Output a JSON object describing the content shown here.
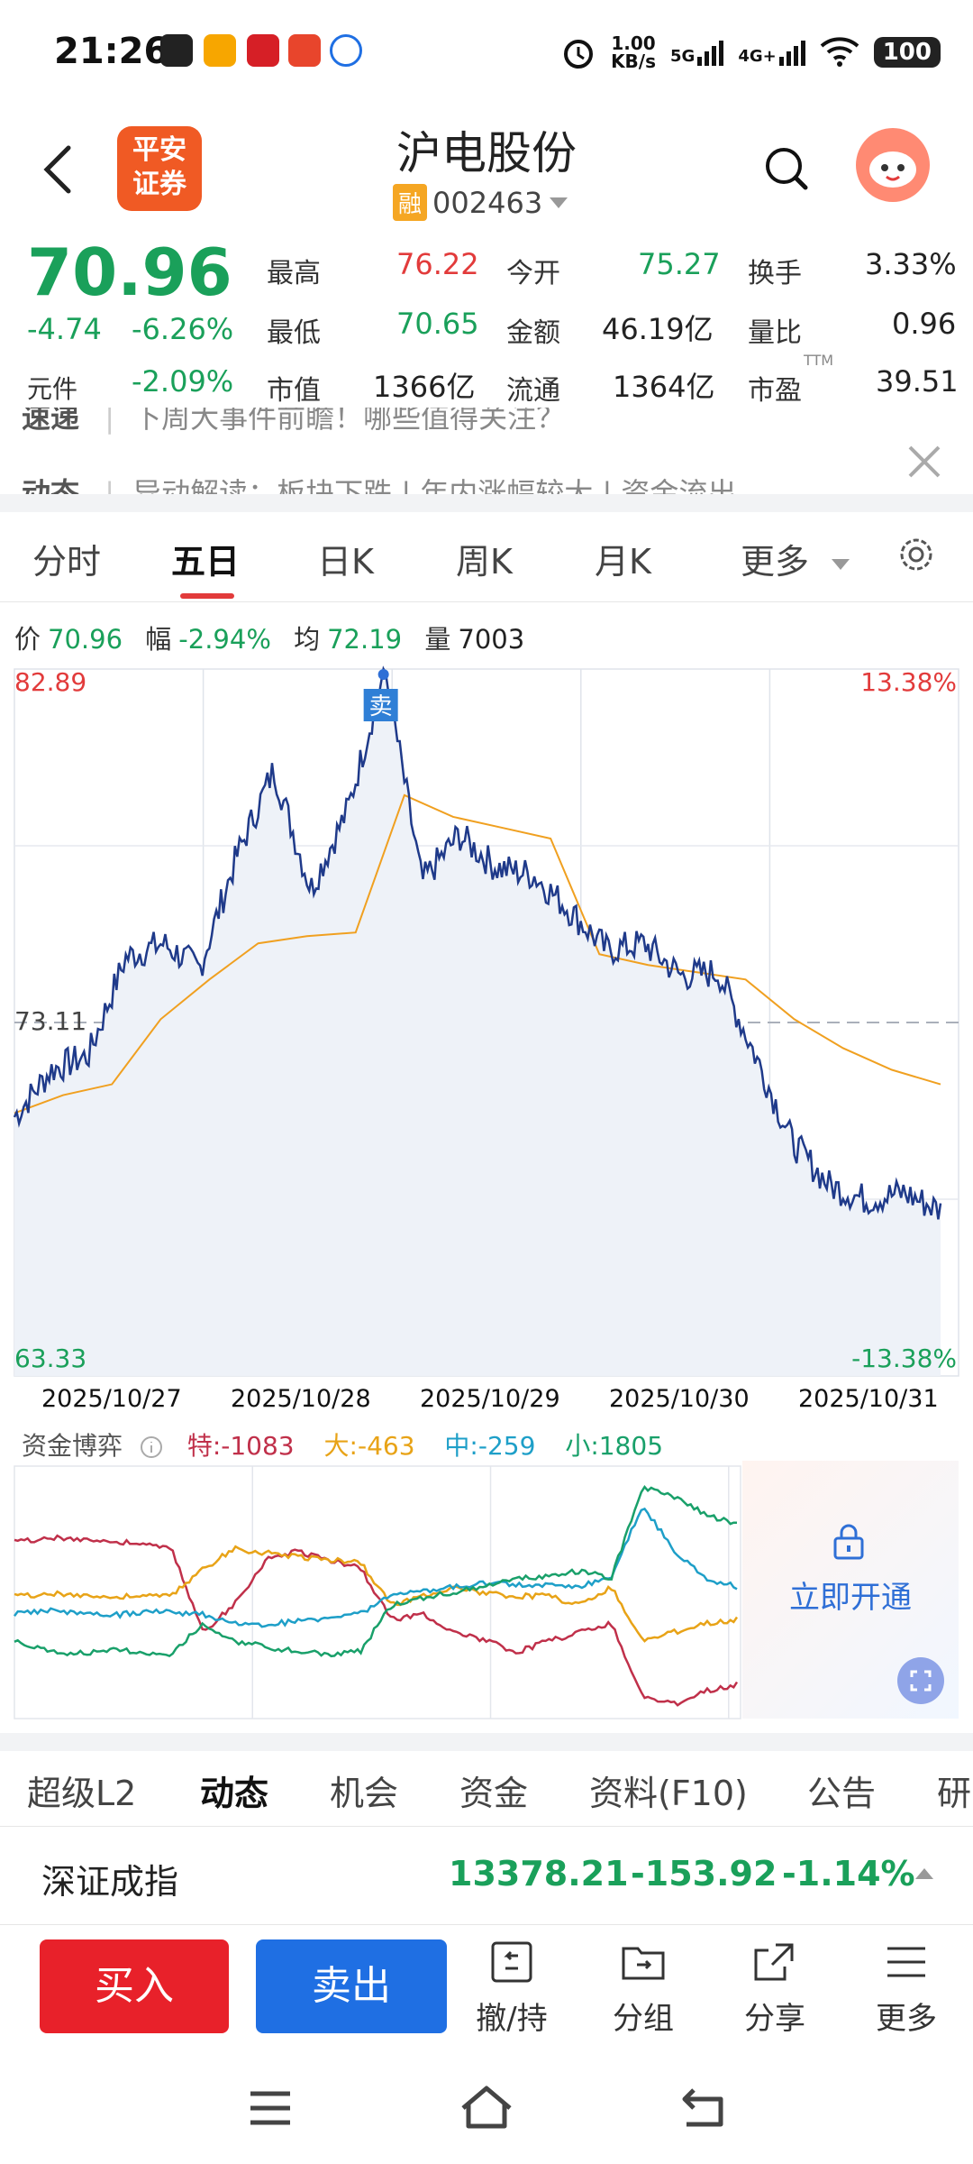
{
  "status_bar": {
    "time": "21:26",
    "net_speed_value": "1.00",
    "net_speed_unit": "KB/s",
    "sig1": "5G",
    "sig2": "4G+",
    "battery": "100"
  },
  "header": {
    "logo_text_1": "平安",
    "logo_text_2": "证券",
    "stock_name": "沪电股份",
    "rong_badge": "融",
    "stock_code": "002463"
  },
  "quote": {
    "price": "70.96",
    "change": "-4.74",
    "change_pct": "-6.26%",
    "yuanjian_label": "元件",
    "yuanjian_value": "-2.09%",
    "high_label": "最高",
    "high_value": "76.22",
    "low_label": "最低",
    "low_value": "70.65",
    "mktcap_label": "市值",
    "mktcap_value": "1366亿",
    "open_label": "今开",
    "open_value": "75.27",
    "amount_label": "金额",
    "amount_value": "46.19亿",
    "float_label": "流通",
    "float_value": "1364亿",
    "turnover_label": "换手",
    "turnover_value": "3.33%",
    "vol_ratio_label": "量比",
    "vol_ratio_value": "0.96",
    "pe_label": "市盈",
    "pe_sup": "TTM",
    "pe_value": "39.51"
  },
  "news": {
    "line1_tag": "速递",
    "line1_text": "下周大事件前瞻！哪些值得关注？",
    "line2_tag": "动态",
    "line2_text": "异动解读：板块下跌 | 年内涨幅较大 | 资金流出"
  },
  "tabs": [
    "分时",
    "五日",
    "日K",
    "周K",
    "月K",
    "更多"
  ],
  "chart_info": {
    "price_label": "价",
    "price_value": "70.96",
    "range_label": "幅",
    "range_value": "-2.94%",
    "avg_label": "均",
    "avg_value": "72.19",
    "vol_label": "量",
    "vol_value": "7003"
  },
  "chart_data": {
    "type": "line",
    "y_top": "82.89",
    "y_mid": "73.11",
    "y_bottom": "63.33",
    "pct_top": "13.38%",
    "pct_bottom": "-13.38%",
    "ylim": [
      63.33,
      82.89
    ],
    "sell_marker": "卖",
    "dates": [
      "2025/10/27",
      "2025/10/28",
      "2025/10/29",
      "2025/10/30",
      "2025/10/31"
    ],
    "series": [
      {
        "name": "价",
        "color": "#1f3a8a",
        "values": [
          70.5,
          71.8,
          72.2,
          74.9,
          75.3,
          74.6,
          77.7,
          80.1,
          76.8,
          79.0,
          82.89,
          77.0,
          78.3,
          77.4,
          77.2,
          76.2,
          75.1,
          75.3,
          74.4,
          74.5,
          72.2,
          69.8,
          68.6,
          68.2,
          68.4,
          67.9
        ]
      },
      {
        "name": "均",
        "color": "#f0a020",
        "values": [
          70.6,
          71.1,
          71.4,
          73.2,
          74.3,
          75.3,
          75.5,
          75.6,
          79.4,
          78.8,
          78.5,
          78.2,
          75.0,
          74.7,
          74.5,
          74.3,
          73.2,
          72.4,
          71.8,
          71.4
        ]
      }
    ]
  },
  "fund_flow": {
    "title": "资金博弈",
    "te": "特:-1083",
    "da": "大:-463",
    "zhong": "中:-259",
    "xiao": "小:1805",
    "unlock_text": "立即开通"
  },
  "lower_tabs": [
    "超级L2",
    "动态",
    "机会",
    "资金",
    "资料(F10)",
    "公告",
    "研"
  ],
  "index_row": {
    "name": "深证成指",
    "value": "13378.21",
    "change": "-153.92",
    "change_pct": "-1.14%"
  },
  "actions": {
    "buy": "买入",
    "sell": "卖出",
    "cancel_hold": "撤/持",
    "group": "分组",
    "share": "分享",
    "more": "更多"
  },
  "colors": {
    "up": "#e23b3b",
    "down": "#1aa05a",
    "price_line": "#1f3a8a",
    "avg_line": "#f0a020",
    "buy": "#e8212a",
    "sell": "#1f6fe3"
  }
}
